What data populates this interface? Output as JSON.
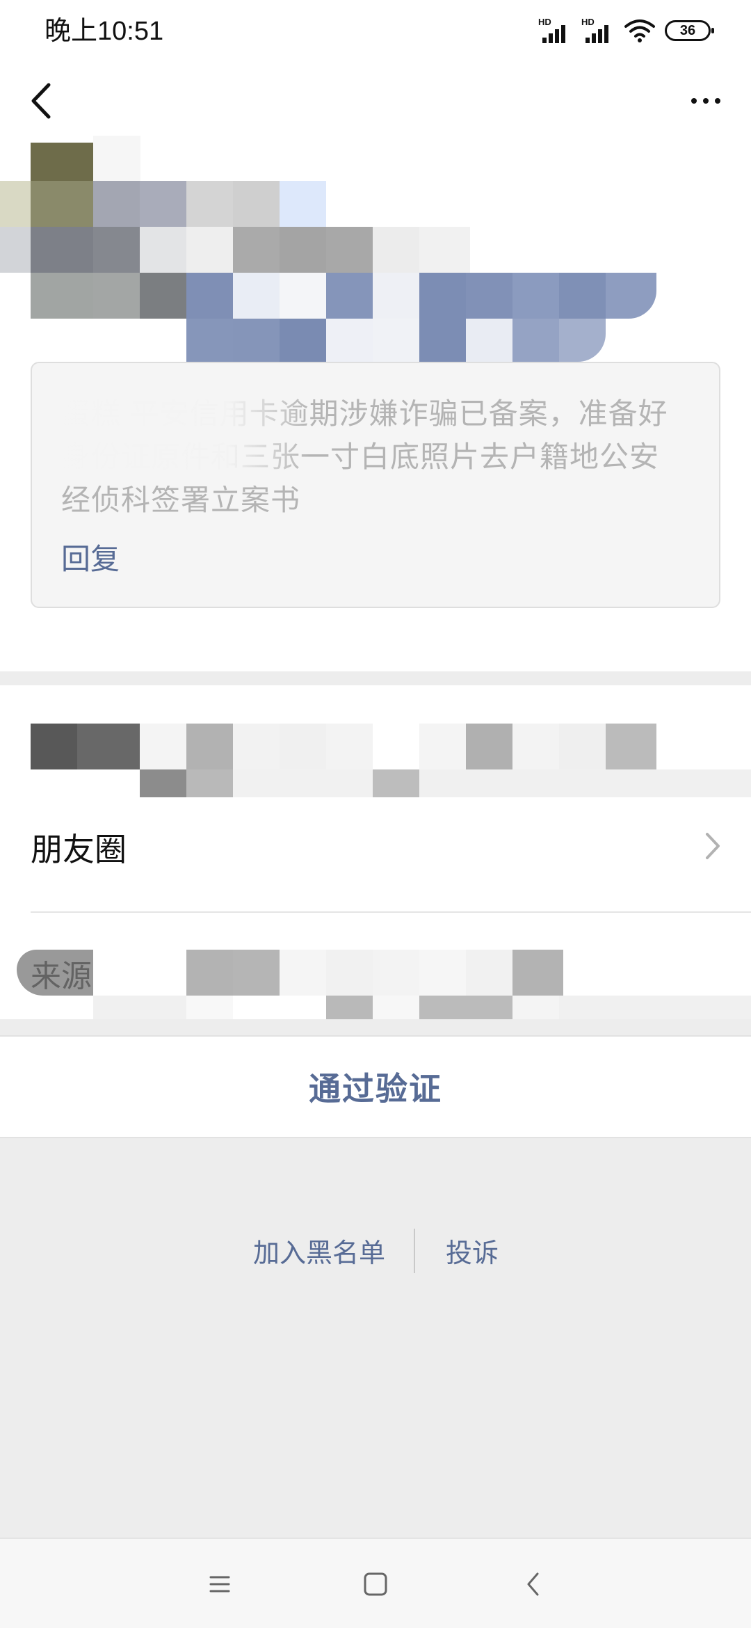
{
  "status_bar": {
    "time": "晚上10:51",
    "signal_label_1": "HD",
    "signal_label_2": "HD",
    "battery": "36"
  },
  "nav": {
    "back_icon": "chevron-left-icon",
    "more_icon": "more-dots-icon"
  },
  "message": {
    "text": "蛋糕     平安信用卡逾期涉嫌诈骗已备案，准备好身份证原件和三张一寸白底照片去户籍地公安经侦科签署立案书",
    "reply_label": "回复"
  },
  "profile_rows": {
    "moments_label": "朋友圈",
    "source_label": "来源"
  },
  "actions": {
    "approve_label": "通过验证",
    "blacklist_label": "加入黑名单",
    "complain_label": "投诉"
  },
  "colors": {
    "link": "#576b95",
    "background": "#ededed"
  },
  "system_nav": {
    "menu_icon": "menu-icon",
    "home_icon": "home-square-icon",
    "back_icon": "back-triangle-icon"
  }
}
